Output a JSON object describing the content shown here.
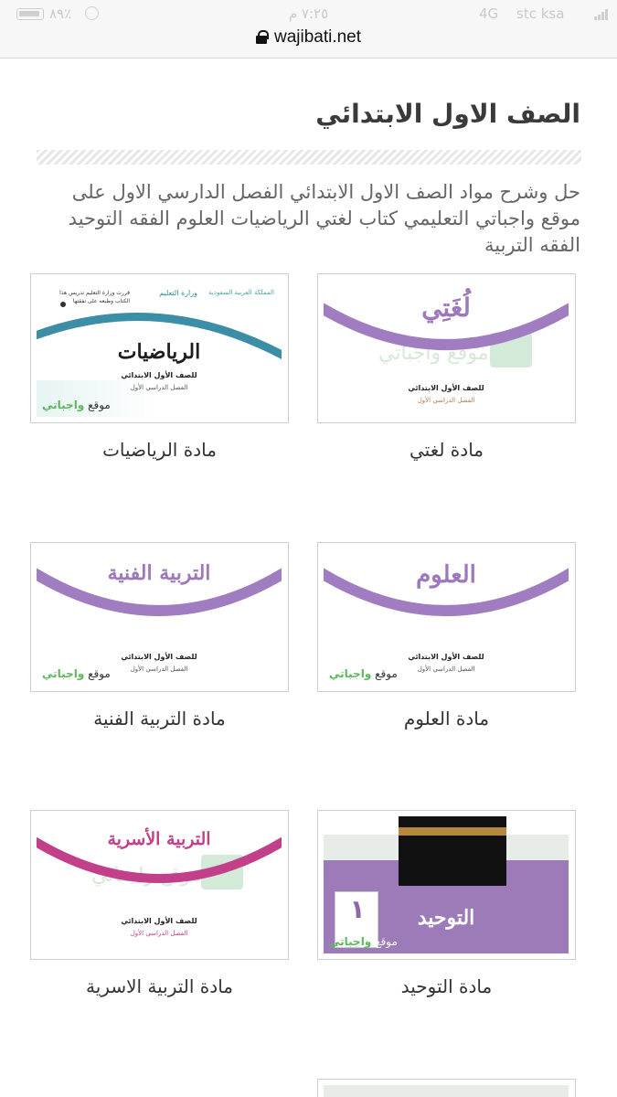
{
  "status_bar": {
    "battery_pct": "٪٨٩",
    "time": "٧:٢٥ م",
    "network": "4G",
    "carrier": "stc ksa"
  },
  "address_bar": {
    "domain": "wajibati.net"
  },
  "page": {
    "title": "الصف الاول الابتدائي",
    "intro": "حل وشرح مواد الصف الاول الابتدائي الفصل الدارسي الاول على موقع واجباتي التعليمي كتاب لغتي الرياضيات العلوم الفقه التوحيد الفقه التربية"
  },
  "cover_common": {
    "grade": "للصف الأول الابتدائي",
    "semester": "الفصل الدراسي الأول",
    "brand_prefix": "موقع",
    "brand_name": "واجباتي",
    "watermark": "موقع واجباتي"
  },
  "math_cover_header": {
    "kingdom": "المملكة العربية السعودية",
    "ministry": "وزارة التعليم",
    "note": "قررت وزارة التعليم تدريس هذا الكتاب وطبعه على نفقتها"
  },
  "subjects": [
    {
      "label": "مادة لغتي",
      "cover_title": "لُغَتِي",
      "arc_color": "#a07cc0"
    },
    {
      "label": "مادة الرياضيات",
      "cover_title": "الرياضيات",
      "arc_color": "#3b8ea5"
    },
    {
      "label": "مادة العلوم",
      "cover_title": "العلوم",
      "arc_color": "#a07cc0"
    },
    {
      "label": "مادة التربية الفنية",
      "cover_title": "التربية الفنية",
      "arc_color": "#a07cc0"
    },
    {
      "label": "مادة التوحيد",
      "cover_title": "التوحيد",
      "cover_number": "١",
      "arc_color": "#9c7bb8"
    },
    {
      "label": "مادة التربية الاسرية",
      "cover_title": "التربية الأسرية",
      "arc_color": "#c2408a"
    }
  ]
}
